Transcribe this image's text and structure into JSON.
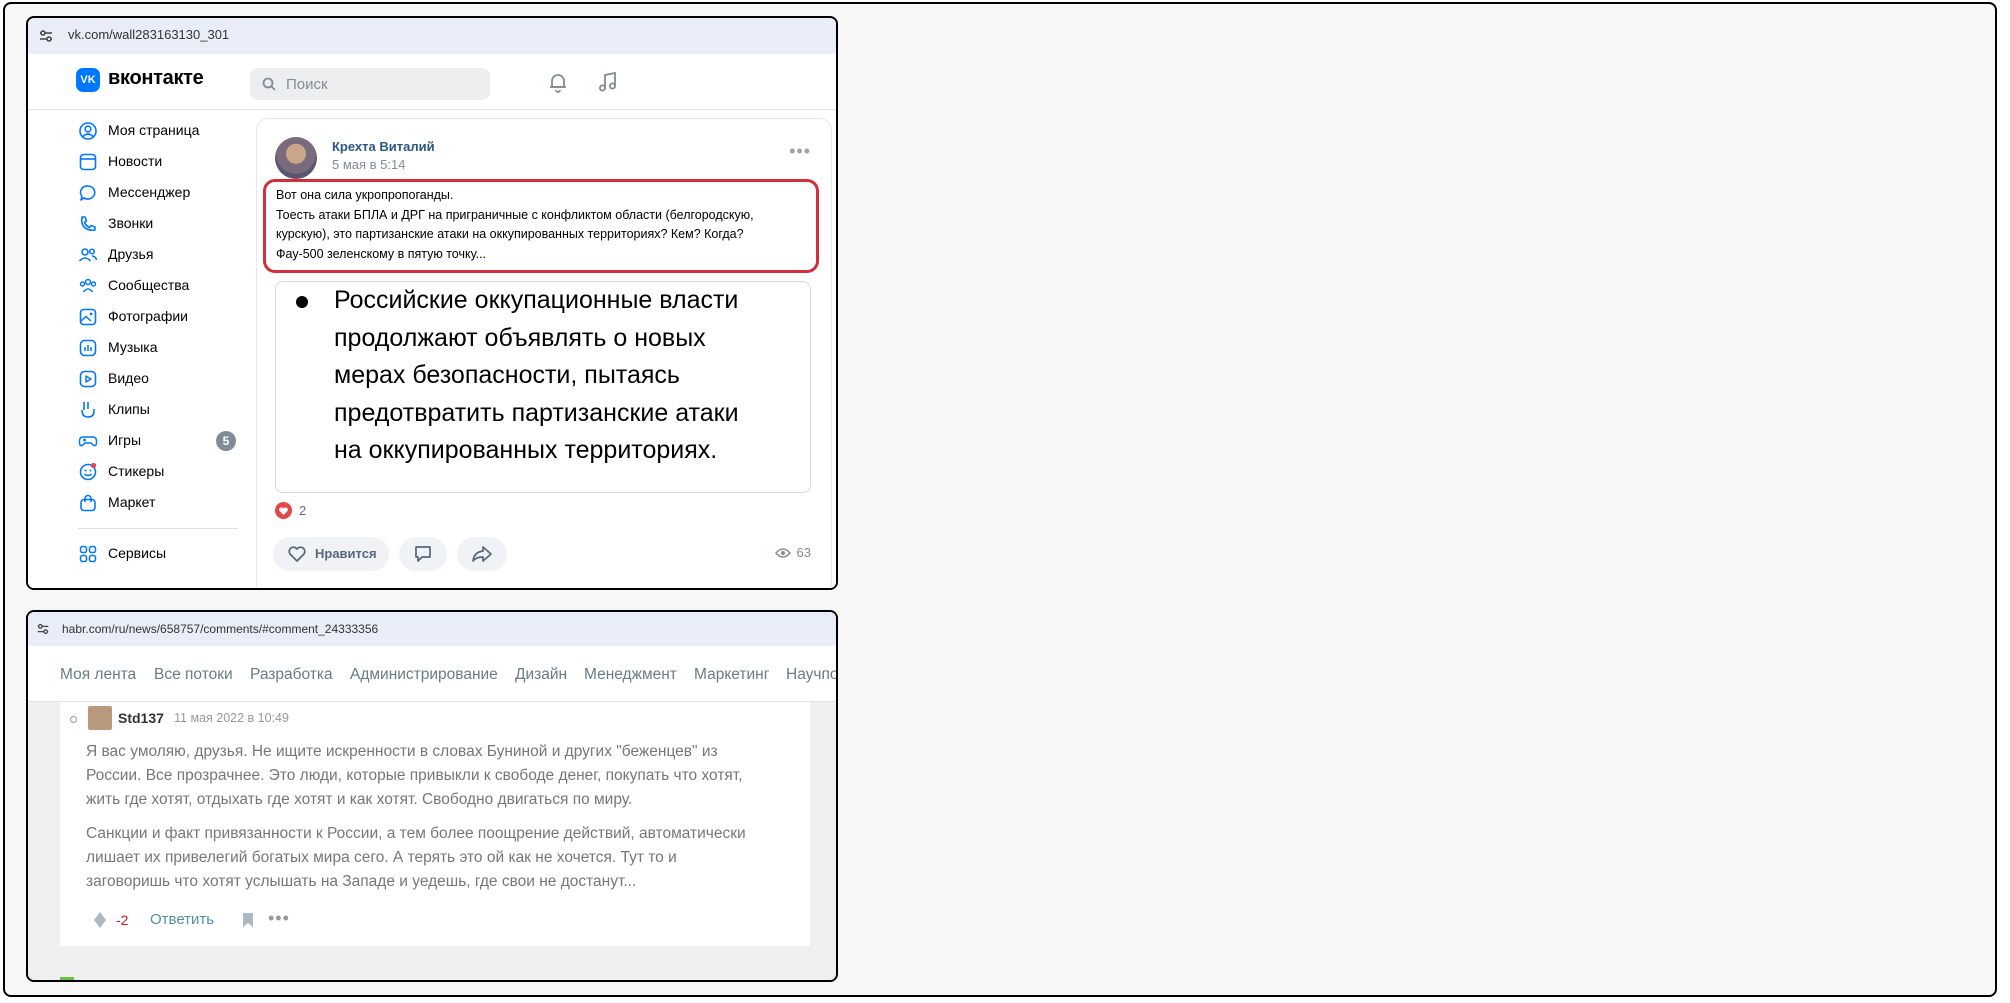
{
  "vk": {
    "url": "vk.com/wall283163130_301",
    "brand": "вконтакте",
    "logo": "VK",
    "search_placeholder": "Поиск",
    "nav": [
      {
        "label": "Моя страница",
        "icon": "user-circle-icon"
      },
      {
        "label": "Новости",
        "icon": "news-icon"
      },
      {
        "label": "Мессенджер",
        "icon": "message-icon"
      },
      {
        "label": "Звонки",
        "icon": "phone-icon"
      },
      {
        "label": "Друзья",
        "icon": "friends-icon"
      },
      {
        "label": "Сообщества",
        "icon": "communities-icon"
      },
      {
        "label": "Фотографии",
        "icon": "photo-icon"
      },
      {
        "label": "Музыка",
        "icon": "music-icon"
      },
      {
        "label": "Видео",
        "icon": "video-icon"
      },
      {
        "label": "Клипы",
        "icon": "clips-icon"
      },
      {
        "label": "Игры",
        "icon": "gamepad-icon",
        "badge": "5"
      },
      {
        "label": "Стикеры",
        "icon": "sticker-icon"
      },
      {
        "label": "Маркет",
        "icon": "market-bag-icon"
      },
      {
        "label": "Сервисы",
        "icon": "services-grid-icon"
      }
    ],
    "post": {
      "author": "Крехта Виталий",
      "date": "5 мая в 5:14",
      "text_lines": [
        "Вот она сила укропропоганды.",
        "Тоесть атаки БПЛА и ДРГ на приграничные с конфликтом области (белгородскую,",
        "курскую), это партизанские атаки на оккупированных территориях? Кем? Когда?",
        "Фау-500 зеленскому в пятую точку..."
      ],
      "quote_lines": [
        "Российские оккупационные власти",
        "продолжают объявлять о новых",
        "мерах безопасности, пытаясь",
        "предотвратить партизанские атаки",
        "на оккупированных территориях."
      ],
      "reactions": "2",
      "like_label": "Нравится",
      "views": "63"
    },
    "colors": {
      "accent": "#0077ff",
      "highlight": "#d42e3b"
    }
  },
  "habr": {
    "url": "habr.com/ru/news/658757/comments/#comment_24333356",
    "tabs": [
      "Моя лента",
      "Все потоки",
      "Разработка",
      "Администрирование",
      "Дизайн",
      "Менеджмент",
      "Маркетинг",
      "Научпоп"
    ],
    "comment": {
      "user": "Std137",
      "date": "11 мая 2022 в 10:49",
      "para1": [
        "Я вас умоляю, друзья. Не ищите искренности в словах Буниной и других \"беженцев\" из",
        "России. Все прозрачнее. Это люди, которые привыкли к свободе денег, покупать что хотят,",
        "жить где хотят, отдыхать где хотят и как хотят. Свободно двигаться по миру."
      ],
      "para2": [
        "Санкции и факт привязанности к России, а тем более поощрение действий, автоматически",
        "лишает их привелегий богатых мира сего. А терять это ой как не хочется. Тут то и",
        "заговоришь что хотят услышать на Западе и уедешь, где свои не достанут..."
      ],
      "score": "-2",
      "reply_label": "Ответить"
    }
  }
}
